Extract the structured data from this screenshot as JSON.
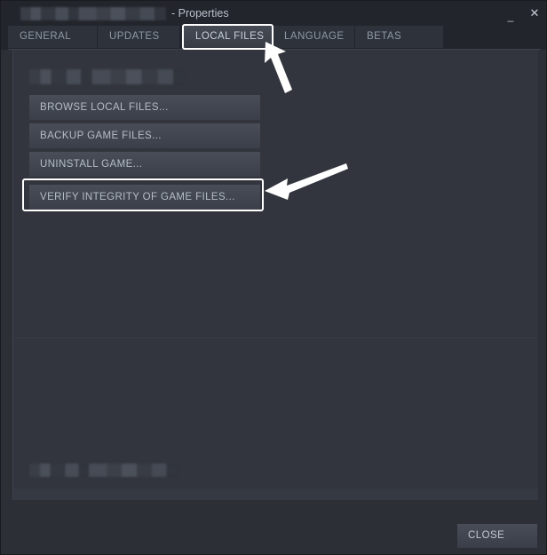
{
  "window": {
    "title_redacted": true,
    "title_suffix": "- Properties",
    "controls": {
      "minimize_label": "_",
      "close_label": "✕"
    }
  },
  "tabs": [
    {
      "id": "general",
      "label": "GENERAL",
      "active": false
    },
    {
      "id": "updates",
      "label": "UPDATES",
      "active": false
    },
    {
      "id": "local_files",
      "label": "LOCAL FILES",
      "active": true
    },
    {
      "id": "language",
      "label": "LANGUAGE",
      "active": false
    },
    {
      "id": "betas",
      "label": "BETAS",
      "active": false
    }
  ],
  "panel": {
    "section_heading_redacted": true,
    "buttons": [
      {
        "id": "browse",
        "label": "BROWSE LOCAL FILES..."
      },
      {
        "id": "backup",
        "label": "BACKUP GAME FILES..."
      },
      {
        "id": "uninstall",
        "label": "UNINSTALL GAME..."
      },
      {
        "id": "verify",
        "label": "VERIFY INTEGRITY OF GAME FILES..."
      }
    ],
    "footer_text_redacted": true
  },
  "footer": {
    "close_label": "CLOSE"
  },
  "annotations": {
    "arrow_color": "#ffffff",
    "highlight_color": "#ffffff",
    "targets": [
      "local-files-tab",
      "verify-integrity-button"
    ]
  },
  "colors": {
    "window_background": "#2c2f36",
    "titlebar_background": "#22252b",
    "panel_background": "#32353d",
    "button_face_top": "#484d57",
    "button_face_bottom": "#3b3f49",
    "active_tab_top": "#464b55",
    "inactive_tab": "#2e323a",
    "text_primary": "#c2c9d4",
    "text_muted": "#8f98a6"
  }
}
